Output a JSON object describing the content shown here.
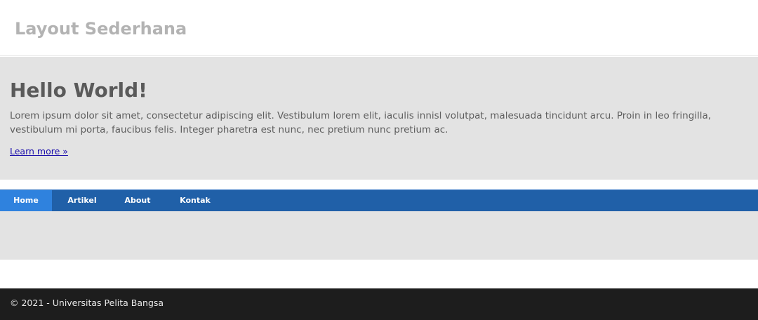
{
  "header": {
    "title": "Layout Sederhana"
  },
  "hero": {
    "title": "Hello World!",
    "text": "Lorem ipsum dolor sit amet, consectetur adipiscing elit. Vestibulum lorem elit, iaculis innisl volutpat, malesuada tincidunt arcu. Proin in leo fringilla, vestibulum mi porta, faucibus felis. Integer pharetra est nunc, nec pretium nunc pretium ac.",
    "link_label": "Learn more »"
  },
  "nav": {
    "items": [
      {
        "label": "Home",
        "active": true
      },
      {
        "label": "Artikel",
        "active": false
      },
      {
        "label": "About",
        "active": false
      },
      {
        "label": "Kontak",
        "active": false
      }
    ]
  },
  "footer": {
    "text": "© 2021 - Universitas Pelita Bangsa"
  },
  "colors": {
    "nav_bg": "#2060a8",
    "nav_active": "#2f82de",
    "hero_bg": "#e3e3e3",
    "footer_bg": "#1d1d1d",
    "link": "#1a0dab"
  }
}
